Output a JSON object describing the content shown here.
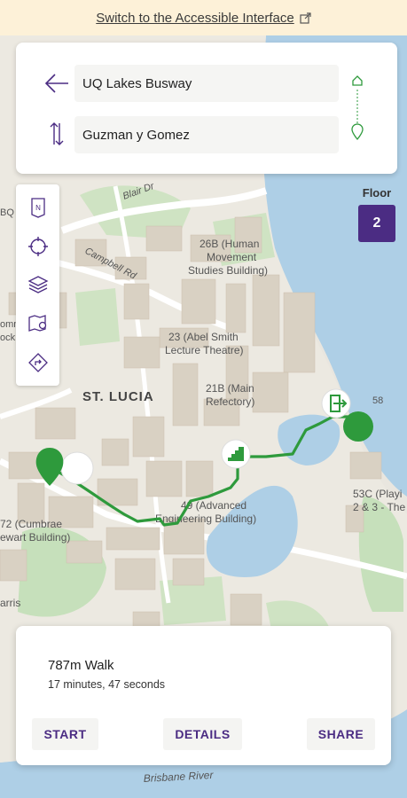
{
  "banner": {
    "text": "Switch to the Accessible Interface",
    "icon": "external-link-icon"
  },
  "route": {
    "from_value": "UQ Lakes Busway",
    "to_value": "Guzman y Gomez",
    "back_icon": "back-arrow-icon",
    "swap_icon": "swap-vertical-icon"
  },
  "floor": {
    "label": "Floor",
    "value": "2"
  },
  "toolbar": [
    "compass-icon",
    "locate-icon",
    "layers-icon",
    "map-pin-icon",
    "directions-icon"
  ],
  "map_labels": {
    "campus": "ST. LUCIA",
    "blair": "Blair Dr",
    "campbell": "Campbell Rd",
    "hm1": "26B (Human",
    "hm2": "Movement",
    "hm3": "Studies Building)",
    "as1": "23 (Abel Smith",
    "as2": "Lecture Theatre)",
    "mr1": "21B (Main",
    "mr2": "Refectory)",
    "ae1": "49 (Advanced",
    "ae2": "Engineering Building)",
    "cb1": "72 (Cumbrae",
    "cb2": "ewart Building)",
    "pl1": "53C (Playi",
    "pl2": "2 & 3 - The",
    "n58": "58",
    "bq": "BQ",
    "omn": "omn",
    "ock": "ock",
    "arris": "arris",
    "river": "Brisbane River"
  },
  "summary": {
    "distance": "787m Walk",
    "duration": "17 minutes, 47 seconds"
  },
  "actions": {
    "start": "START",
    "details": "DETAILS",
    "share": "SHARE"
  },
  "colors": {
    "accent": "#4b2c83",
    "route": "#2e9a3c",
    "water": "#aecfe6",
    "building": "#d9d1c3"
  }
}
